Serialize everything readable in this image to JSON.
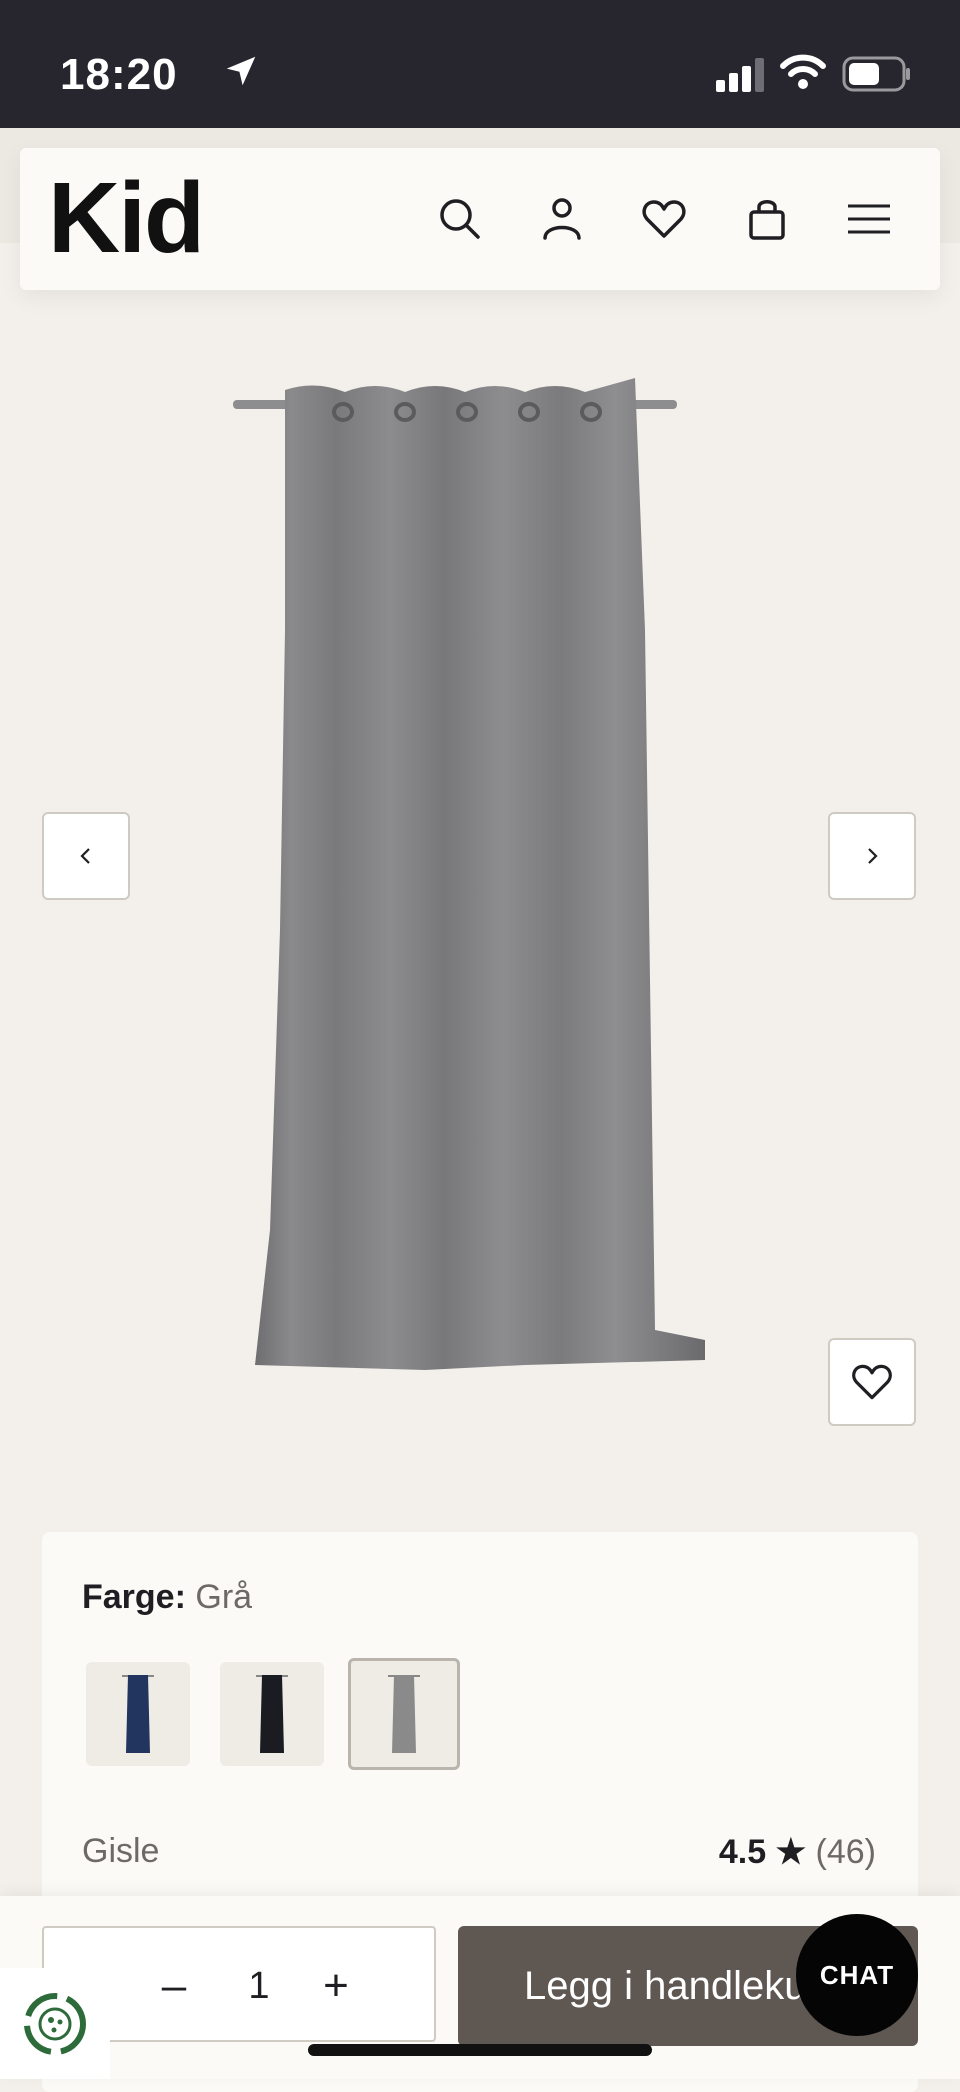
{
  "status_bar": {
    "time": "18:20"
  },
  "header": {
    "logo": "Kid"
  },
  "product": {
    "color_label": "Farge:",
    "color_value": "Grå",
    "swatches": [
      {
        "name": "Blue",
        "color": "#22355f"
      },
      {
        "name": "Black",
        "color": "#1a1c22"
      },
      {
        "name": "Grey",
        "color": "#8a8a8a",
        "selected": true
      }
    ],
    "name": "Gisle",
    "rating": "4.5",
    "rating_star": "★",
    "review_count": "(46)"
  },
  "cart": {
    "quantity": "1",
    "minus_label": "–",
    "plus_label": "+",
    "add_to_cart_label": "Legg i handlekurv"
  },
  "chat": {
    "label": "CHAT"
  },
  "colors": {
    "cart_button": "#5f5752",
    "background": "#f3f0eb",
    "panel": "#fbfaf6"
  }
}
